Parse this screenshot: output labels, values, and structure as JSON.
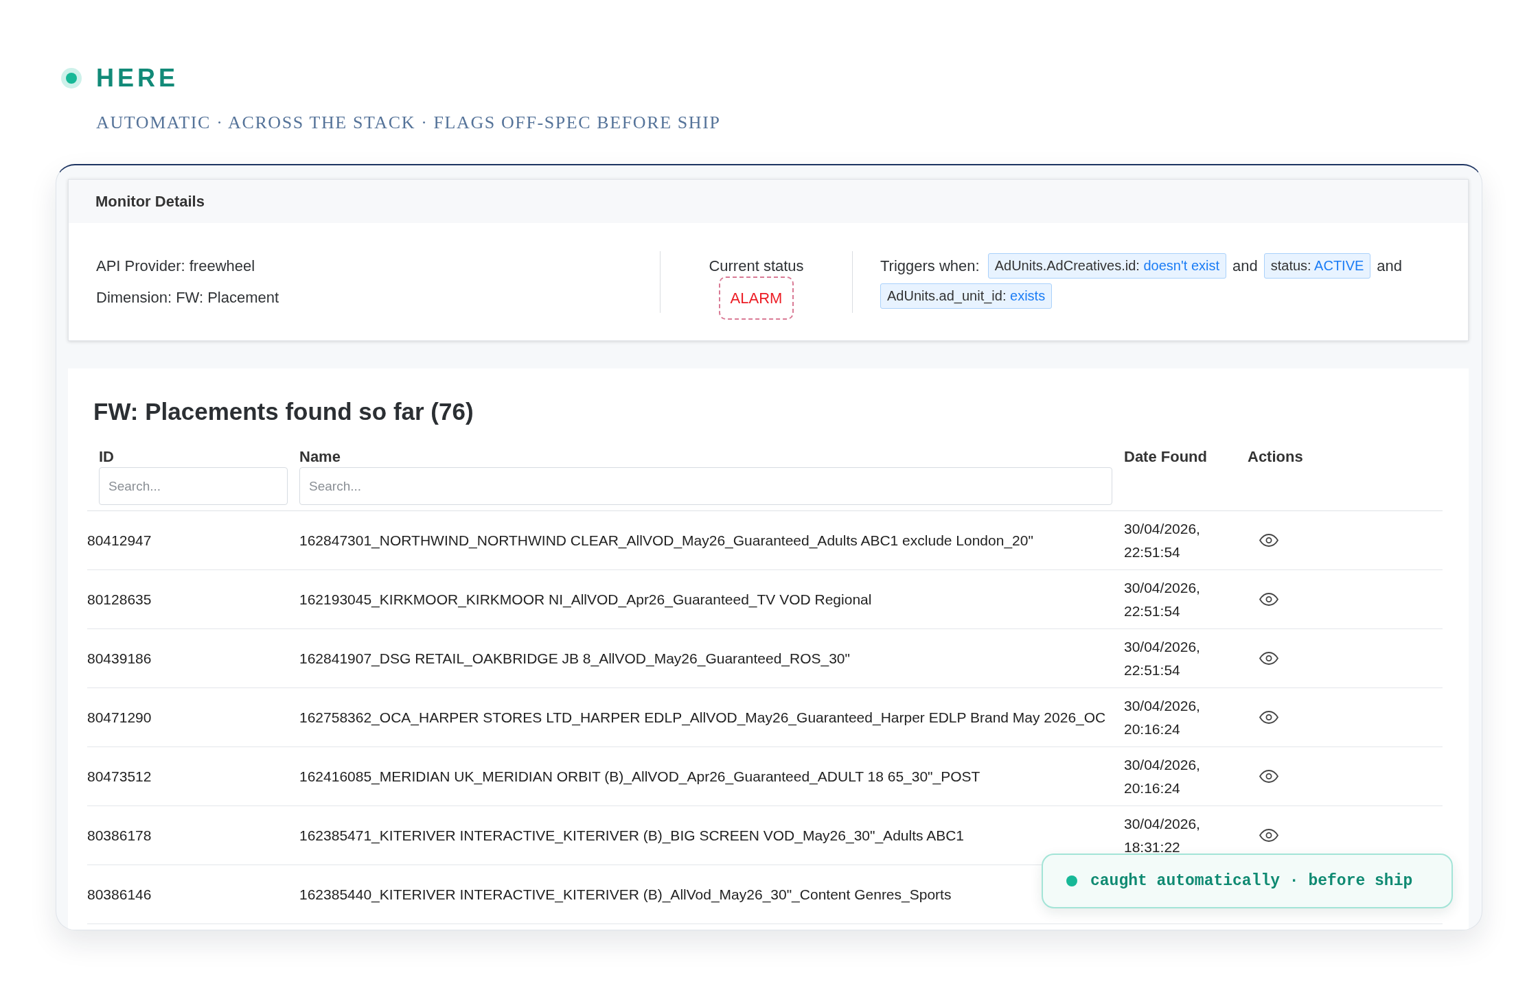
{
  "brand": {
    "name": "HERE",
    "tagline": "AUTOMATIC · ACROSS THE STACK · FLAGS OFF-SPEC BEFORE SHIP"
  },
  "monitor_details": {
    "title": "Monitor Details",
    "fields": [
      "API Provider: freewheel",
      "Dimension: FW: Placement"
    ],
    "status": {
      "label": "Current status",
      "value": "ALARM",
      "kind": "alarm"
    },
    "triggers": {
      "label": "Triggers when:",
      "items": [
        {
          "kind": "condition",
          "field": "AdUnits.AdCreatives.id:",
          "value": "doesn't exist"
        },
        {
          "kind": "joiner",
          "text": "and"
        },
        {
          "kind": "condition",
          "field": "status:",
          "value": "ACTIVE"
        },
        {
          "kind": "joiner",
          "text": "and"
        },
        {
          "kind": "condition",
          "field": "AdUnits.ad_unit_id:",
          "value": "exists"
        }
      ]
    }
  },
  "placements": {
    "title": "FW: Placements found so far (76)",
    "columns": [
      {
        "label": "ID",
        "filter": {
          "placeholder": "Search..."
        }
      },
      {
        "label": "Name",
        "filter": {
          "placeholder": "Search..."
        }
      },
      {
        "label": "Date Found"
      },
      {
        "label": "Actions"
      }
    ],
    "rows": [
      {
        "id": "80412947",
        "name": "162847301_NORTHWIND_NORTHWIND CLEAR_AllVOD_May26_Guaranteed_Adults ABC1 exclude London_20\"",
        "date_found": "30/04/2026, 22:51:54",
        "actions": [
          {
            "kind": "view"
          }
        ]
      },
      {
        "id": "80128635",
        "name": "162193045_KIRKMOOR_KIRKMOOR NI_AllVOD_Apr26_Guaranteed_TV VOD Regional",
        "date_found": "30/04/2026, 22:51:54",
        "actions": [
          {
            "kind": "view"
          }
        ]
      },
      {
        "id": "80439186",
        "name": "162841907_DSG RETAIL_OAKBRIDGE JB 8_AllVOD_May26_Guaranteed_ROS_30\"",
        "date_found": "30/04/2026, 22:51:54",
        "actions": [
          {
            "kind": "view"
          }
        ]
      },
      {
        "id": "80471290",
        "name": "162758362_OCA_HARPER STORES LTD_HARPER EDLP_AllVOD_May26_Guaranteed_Harper EDLP Brand May 2026_OC",
        "date_found": "30/04/2026, 20:16:24",
        "actions": [
          {
            "kind": "view"
          }
        ]
      },
      {
        "id": "80473512",
        "name": "162416085_MERIDIAN UK_MERIDIAN ORBIT (B)_AllVOD_Apr26_Guaranteed_ADULT 18 65_30\"_POST",
        "date_found": "30/04/2026, 20:16:24",
        "actions": [
          {
            "kind": "view"
          }
        ]
      },
      {
        "id": "80386178",
        "name": "162385471_KITERIVER INTERACTIVE_KITERIVER (B)_BIG SCREEN VOD_May26_30\"_Adults ABC1",
        "date_found": "30/04/2026, 18:31:22",
        "actions": [
          {
            "kind": "view"
          }
        ]
      },
      {
        "id": "80386146",
        "name": "162385440_KITERIVER INTERACTIVE_KITERIVER (B)_AllVod_May26_30\"_Content Genres_Sports"
      }
    ]
  },
  "toast": {
    "kind": "success",
    "text": "caught automatically · before ship"
  }
}
